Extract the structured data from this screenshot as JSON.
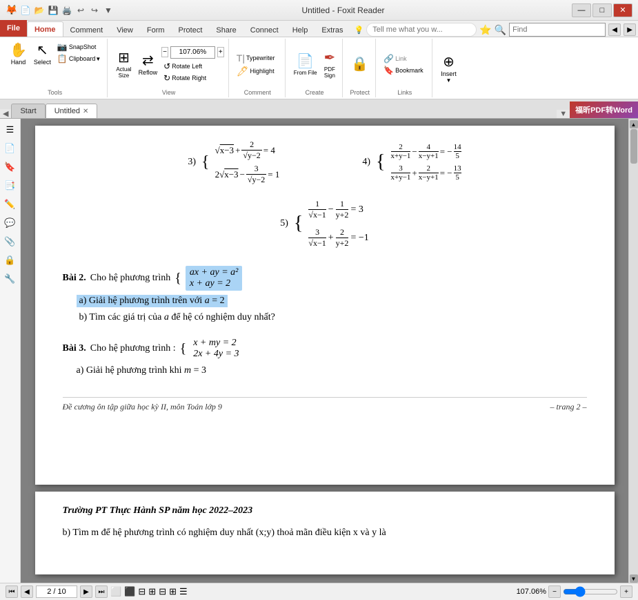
{
  "window": {
    "title": "Untitled - Foxit Reader",
    "min_label": "—",
    "max_label": "□",
    "close_label": "✕"
  },
  "app_tabs": [
    {
      "label": "File",
      "active": true
    },
    {
      "label": "Home",
      "active": false
    },
    {
      "label": "Comment",
      "active": false
    },
    {
      "label": "View",
      "active": false
    },
    {
      "label": "Form",
      "active": false
    },
    {
      "label": "Protect",
      "active": false
    },
    {
      "label": "Share",
      "active": false
    },
    {
      "label": "Connect",
      "active": false
    },
    {
      "label": "Help",
      "active": false
    },
    {
      "label": "Extras",
      "active": false
    }
  ],
  "file_tab_label": "File",
  "home_tab_label": "Home",
  "toolbar": {
    "snapshot_label": "SnapShot",
    "clipboard_label": "Clipboard",
    "hand_label": "Hand",
    "select_label": "Select",
    "actual_size_label": "Actual\nSize",
    "reflow_label": "Reflow",
    "rotate_left_label": "Rotate Left",
    "rotate_right_label": "Rotate Right",
    "zoom_value": "107.06%",
    "typewriter_label": "Typewriter",
    "highlight_label": "Highlight",
    "from_file_label": "From\nFile",
    "pdf_sign_label": "PDF\nSign",
    "link_label": "Link",
    "bookmark_label": "Bookmark",
    "insert_label": "Insert",
    "groups": [
      "Tools",
      "View",
      "Comment",
      "Create",
      "Protect",
      "Links"
    ]
  },
  "tellme_placeholder": "Tell me what you w...",
  "search_placeholder": "Find",
  "doc_tabs": [
    {
      "label": "Start",
      "active": false,
      "closeable": false
    },
    {
      "label": "Untitled",
      "active": true,
      "closeable": true
    }
  ],
  "nav_tabs_dropdown": "▼",
  "left_sidebar_tools": [
    "☰",
    "📄",
    "🔖",
    "📑",
    "✏️",
    "💬",
    "🔗",
    "🔒",
    "🔨"
  ],
  "pdf_pages": [
    {
      "corner_badge": "福昕PDF转Word",
      "content_items": [
        {
          "type": "system_problem",
          "number": "3)",
          "equations": [
            "√(x−3) + 2/√(y−2) = 4",
            "2√(x−3) − 3/√(y−2) = 1"
          ]
        },
        {
          "type": "system_problem",
          "number": "4)",
          "equations": [
            "2/(x+y−1) − 4/(x−y+1) = −14/5",
            "3/(x+y−1) + 2/(x−y+1) = −13/5"
          ]
        },
        {
          "type": "system_problem",
          "number": "5)",
          "equations": [
            "1/√(x−1) − 1/(y+2) = 3",
            "3/√(x−1) + 2/(y+2) = −1"
          ]
        },
        {
          "type": "paragraph",
          "text": "Bài 2. Cho hệ phương trình",
          "highlight_system": true,
          "system_eqs": [
            "ax + ay = a²",
            "x + ay = 2"
          ],
          "sub_items": [
            "a)  Giải hệ phương trình trên với a = 2",
            "b)  Tìm các giá trị của a để hệ có nghiệm duy nhất?"
          ]
        },
        {
          "type": "paragraph",
          "text": "Bài 3. Cho hệ phương trình :",
          "system_eqs": [
            "x + my = 2",
            "2x + 4y = 3"
          ],
          "sub_items": [
            "a)   Giải hệ phương trình khi m = 3"
          ]
        }
      ],
      "footer": "Đề cương ôn tập giữa học kỳ II, môn Toán lớp 9",
      "footer_right": "– trang 2 –"
    },
    {
      "content_items": [
        {
          "type": "paragraph",
          "text": "Trường PT Thực Hành SP năm học 2022–2023",
          "italic_bold": true
        },
        {
          "type": "paragraph",
          "text": "b)  Tìm m để hệ phương trình có nghiệm duy nhất (x;y) thoả mãn điều kiện x và y là"
        }
      ]
    }
  ],
  "statusbar": {
    "first_label": "⏮",
    "prev_label": "◀",
    "page_value": "2 / 10",
    "next_label": "▶",
    "last_label": "⏭",
    "fit_width": "⬛",
    "fit_page": "⬛",
    "icons": [
      "⊟",
      "⊟",
      "⊟",
      "⊟",
      "⊟"
    ],
    "zoom_value": "107.06%",
    "zoom_out": "−",
    "zoom_in": "+",
    "zoom_slider_val": 60
  }
}
